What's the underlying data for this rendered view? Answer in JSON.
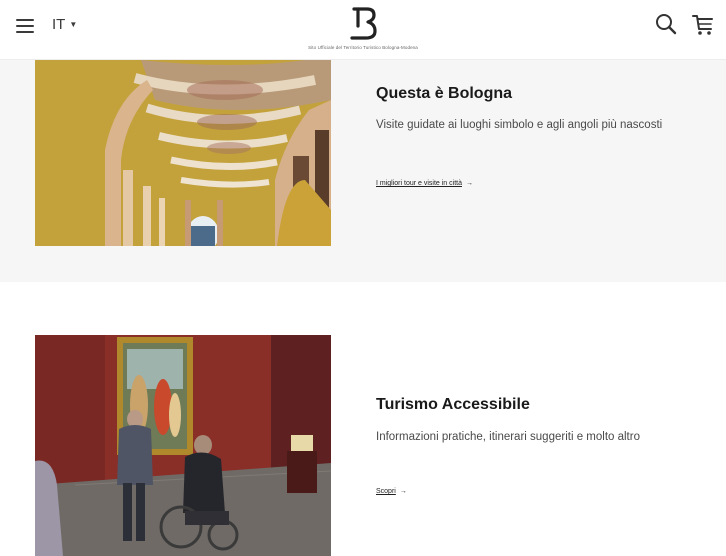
{
  "header": {
    "language": "IT",
    "tagline": "Sito Ufficiale del Territorio Turistico Bologna-Modena"
  },
  "cards": [
    {
      "title": "Questa è Bologna",
      "description": "Visite guidate ai luoghi simbolo e agli angoli più nascosti",
      "link": "I migliori tour e visite in città",
      "arrow": "→"
    },
    {
      "title": "Turismo Accessibile",
      "description": "Informazioni pratiche, itinerari suggeriti e molto altro",
      "link": "Scopri",
      "arrow": "→"
    }
  ],
  "colors": {
    "section_bg": "#f6f6f7",
    "mustard": "#c3a23c",
    "museum_wall": "#8a2e28"
  }
}
